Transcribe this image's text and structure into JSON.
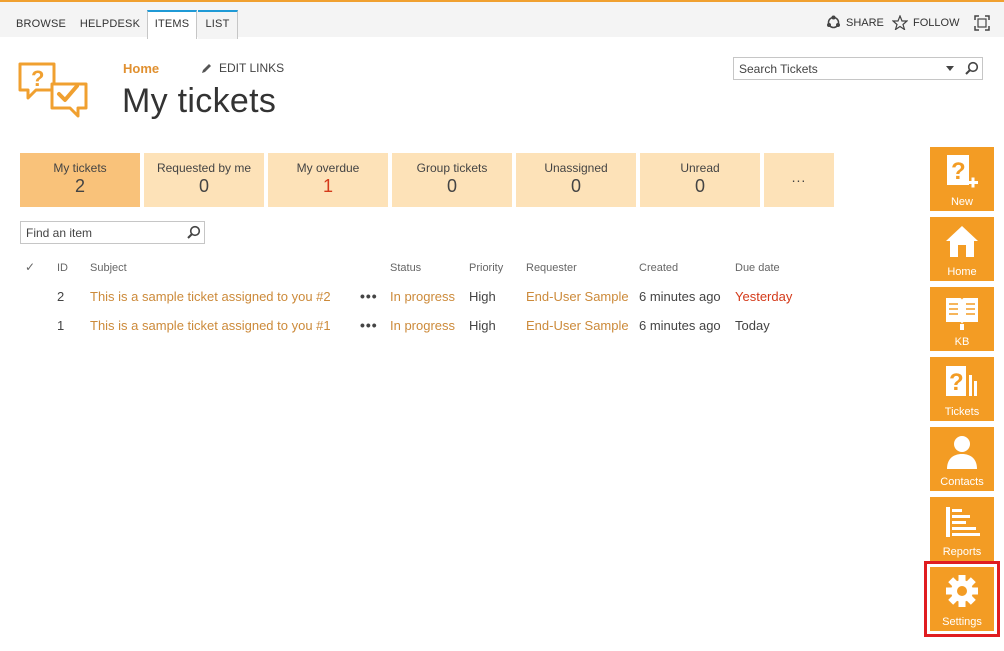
{
  "ribbon": {
    "tabs": [
      {
        "label": "BROWSE"
      },
      {
        "label": "HELPDESK"
      },
      {
        "label": "ITEMS"
      },
      {
        "label": "LIST"
      }
    ],
    "share_label": "SHARE",
    "follow_label": "FOLLOW"
  },
  "header": {
    "breadcrumb_home": "Home",
    "edit_links": "EDIT LINKS",
    "title": "My tickets",
    "search_placeholder": "Search Tickets"
  },
  "tiles": [
    {
      "label": "My tickets",
      "count": "2"
    },
    {
      "label": "Requested by me",
      "count": "0"
    },
    {
      "label": "My overdue",
      "count": "1"
    },
    {
      "label": "Group tickets",
      "count": "0"
    },
    {
      "label": "Unassigned",
      "count": "0"
    },
    {
      "label": "Unread",
      "count": "0"
    },
    {
      "label": "..."
    }
  ],
  "find": {
    "placeholder": "Find an item"
  },
  "table": {
    "headers": {
      "check": "✓",
      "id": "ID",
      "subject": "Subject",
      "status": "Status",
      "priority": "Priority",
      "requester": "Requester",
      "created": "Created",
      "due": "Due date"
    },
    "rows": [
      {
        "id": "2",
        "subject": "This is a sample ticket assigned to you #2",
        "menu": "•••",
        "status": "In progress",
        "priority": "High",
        "requester": "End-User Sample",
        "created": "6 minutes ago",
        "due": "Yesterday"
      },
      {
        "id": "1",
        "subject": "This is a sample ticket assigned to you #1",
        "menu": "•••",
        "status": "In progress",
        "priority": "High",
        "requester": "End-User Sample",
        "created": "6 minutes ago",
        "due": "Today"
      }
    ]
  },
  "right_nav": [
    {
      "label": "New",
      "icon": "new-ticket-icon"
    },
    {
      "label": "Home",
      "icon": "home-icon"
    },
    {
      "label": "KB",
      "icon": "book-icon"
    },
    {
      "label": "Tickets",
      "icon": "tickets-icon"
    },
    {
      "label": "Contacts",
      "icon": "contact-icon"
    },
    {
      "label": "Reports",
      "icon": "reports-icon"
    },
    {
      "label": "Settings",
      "icon": "gear-icon"
    }
  ],
  "colors": {
    "accent": "#f39c24",
    "tile_active": "#f9c27a",
    "tile": "#fde2b8",
    "link": "#cc8a3a",
    "overdue": "#d43a1a",
    "highlight": "#e01d20",
    "ribbon_active": "#1f9ad6"
  }
}
